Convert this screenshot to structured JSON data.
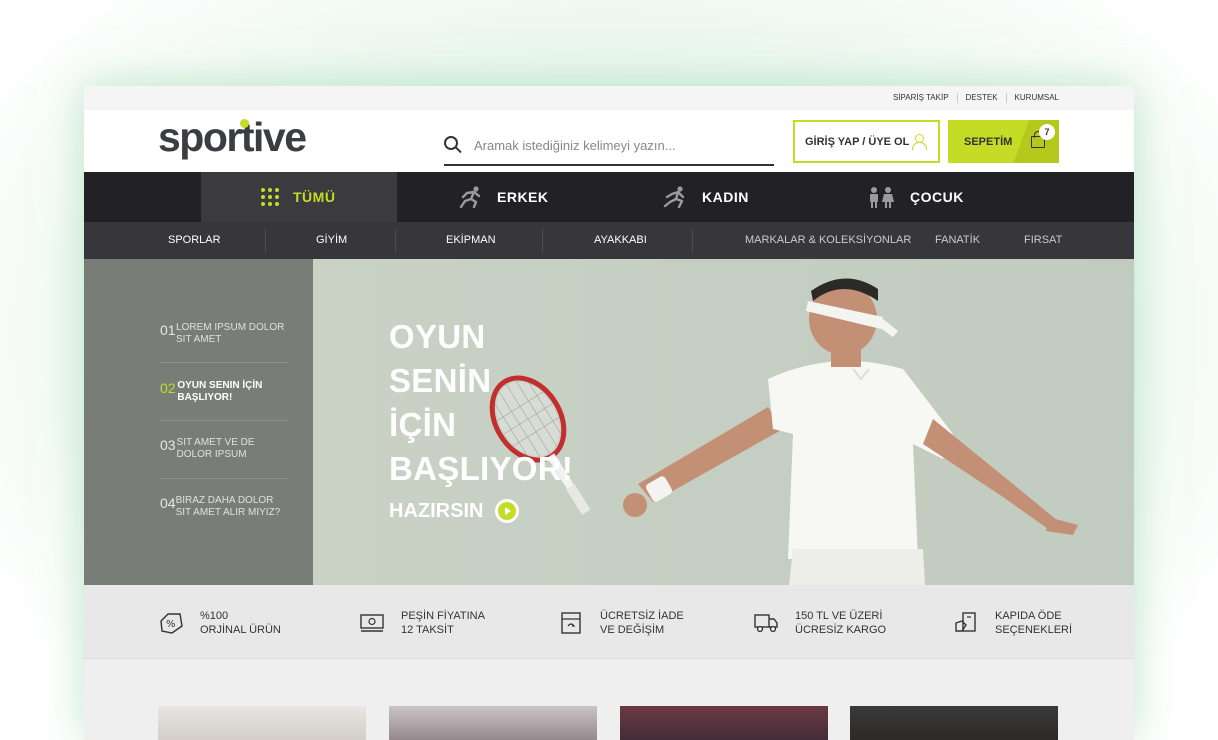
{
  "util_links": [
    "SİPARİŞ TAKİP",
    "DESTEK",
    "KURUMSAL"
  ],
  "logo": "sportive",
  "search": {
    "placeholder": "Aramak istediğiniz kelimeyi yazın..."
  },
  "login_label": "GİRİŞ YAP / ÜYE OL",
  "cart": {
    "label": "SEPETİM",
    "count": "7"
  },
  "main_nav": [
    "TÜMÜ",
    "ERKEK",
    "KADIN",
    "ÇOCUK"
  ],
  "sub_nav": [
    "SPORLAR",
    "GİYİM",
    "EKİPMAN",
    "AYAKKABI",
    "MARKALAR & KOLEKSİYONLAR",
    "FANATİK",
    "FIRSAT"
  ],
  "slides": [
    {
      "num": "01",
      "text": "LOREM IPSUM DOLOR SIT AMET"
    },
    {
      "num": "02",
      "text": "OYUN SENIN İÇİN BAŞLIYOR!"
    },
    {
      "num": "03",
      "text": "SIT AMET VE DE DOLOR IPSUM"
    },
    {
      "num": "04",
      "text": "BIRAZ DAHA DOLOR SIT AMET ALIR MIYIZ?"
    }
  ],
  "hero": {
    "headline": [
      "OYUN",
      "SENİN",
      "İÇİN",
      "BAŞLIYOR!"
    ],
    "cta": "HAZIRSIN"
  },
  "features": [
    {
      "icon": "percent-tag-icon",
      "line1": "%100",
      "line2": "ORJİNAL ÜRÜN"
    },
    {
      "icon": "banknote-icon",
      "line1": "PEŞİN FİYATINA",
      "line2": "12 TAKSİT"
    },
    {
      "icon": "return-box-icon",
      "line1": "ÜCRETSİZ İADE",
      "line2": "VE DEĞİŞİM"
    },
    {
      "icon": "truck-icon",
      "line1": "150 TL VE ÜZERİ",
      "line2": "ÜCRESİZ KARGO"
    },
    {
      "icon": "card-payment-icon",
      "line1": "KAPIDA ÖDE",
      "line2": "SEÇENEKLERİ"
    }
  ],
  "colors": {
    "accent": "#c4dc25",
    "nav_dark": "#222226",
    "subnav": "#36363b"
  }
}
